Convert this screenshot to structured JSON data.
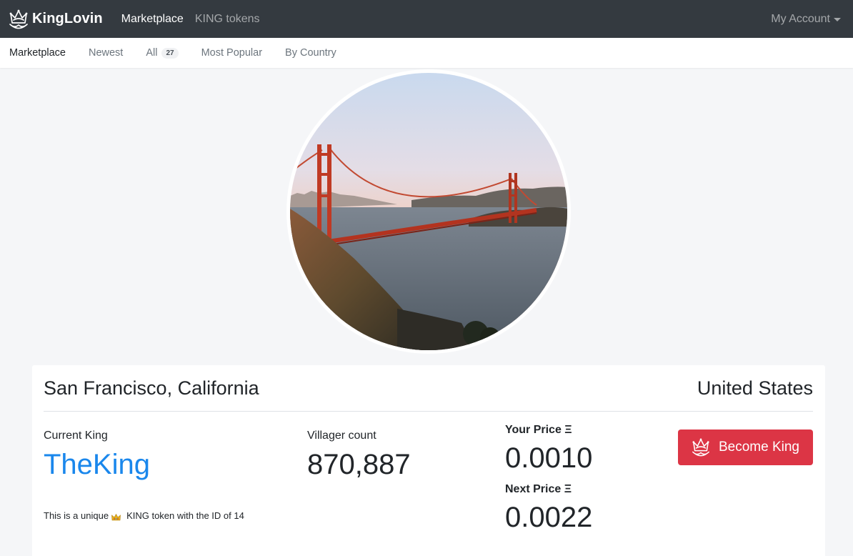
{
  "navbar": {
    "brand": "KingLovin",
    "links": [
      "Marketplace",
      "KING tokens"
    ],
    "account": "My Account"
  },
  "subnav": {
    "items": [
      "Marketplace",
      "Newest",
      "All",
      "Most Popular",
      "By Country"
    ],
    "all_count": "27"
  },
  "token": {
    "city": "San Francisco, California",
    "country": "United States",
    "current_king_label": "Current King",
    "current_king": "TheKing",
    "villager_label": "Villager count",
    "villager_count": "870,887",
    "your_price_label": "Your Price Ξ",
    "your_price": "0.0010",
    "next_price_label": "Next Price Ξ",
    "next_price": "0.0022",
    "description_prefix": "This is a unique",
    "description_suffix": "KING token with the ID of 14",
    "button_label": "Become King"
  },
  "colors": {
    "navbar_bg": "#343a40",
    "accent_blue": "#1a87ec",
    "button_red": "#dc3545"
  },
  "icons": {
    "brand": "crown-icon",
    "button": "crown-icon",
    "description": "crown-emoji-icon",
    "dropdown": "caret-down-icon",
    "hero": "golden-gate-bridge-photo"
  }
}
